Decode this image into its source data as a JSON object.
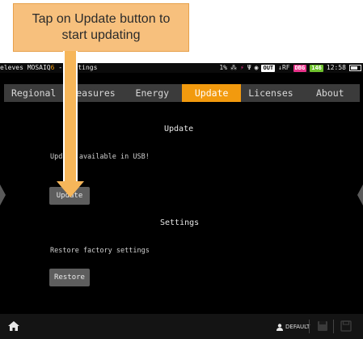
{
  "status_bar": {
    "title_prefix": "eleves MOSAIQ",
    "title_accent": "6",
    "title_suffix": " - Settings",
    "signal": "1%",
    "out_badge": "OUT",
    "rf": "↓RF",
    "dbg_badge": "DBG",
    "count_badge": "146",
    "time": "12:58"
  },
  "tabs": [
    {
      "label": "Regional"
    },
    {
      "label": "Measures"
    },
    {
      "label": "Energy"
    },
    {
      "label": "Update"
    },
    {
      "label": "Licenses"
    },
    {
      "label": "About"
    }
  ],
  "active_tab": "Update",
  "update_section": {
    "heading": "Update",
    "message": "Update available in USB!",
    "button": "Update"
  },
  "settings_section": {
    "heading": "Settings",
    "message": "Restore factory settings",
    "button": "Restore"
  },
  "bottom_bar": {
    "profile_label": "DEFAULT"
  },
  "annotation": {
    "text_line1": "Tap on Update button to",
    "text_line2": "start updating"
  },
  "colors": {
    "accent": "#f29a0e",
    "callout_bg": "#f7c07d",
    "button_bg": "#5d5d5d",
    "dbg": "#e8338a",
    "count": "#6fc22e"
  }
}
